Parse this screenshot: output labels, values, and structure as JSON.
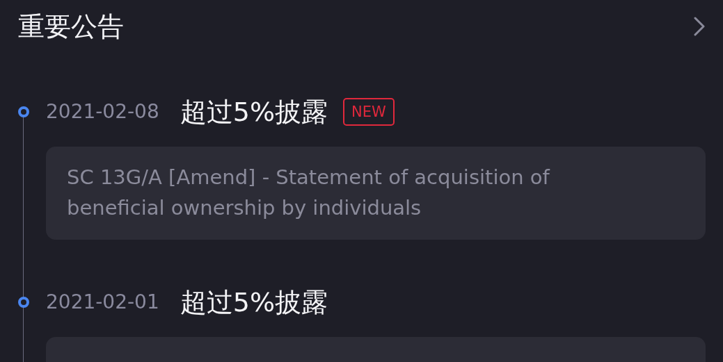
{
  "header": {
    "title": "重要公告"
  },
  "entries": [
    {
      "date": "2021-02-08",
      "title": "超过5%披露",
      "new": true,
      "badge": "NEW",
      "description": "SC 13G/A [Amend]  - Statement of acquisition of beneficial ownership by individuals"
    },
    {
      "date": "2021-02-01",
      "title": "超过5%披露",
      "new": false
    }
  ]
}
